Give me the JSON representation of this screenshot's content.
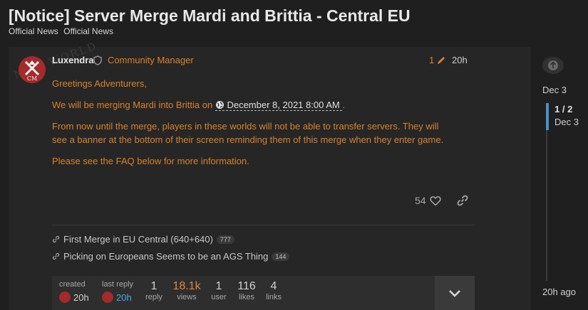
{
  "topic": {
    "title": "[Notice] Server Merge Mardi and Brittia - Central EU",
    "categories": [
      "Official News",
      "Official News"
    ]
  },
  "post": {
    "username": "Luxendra",
    "role": "Community Manager",
    "edit_count": "1",
    "time": "20h",
    "greeting": "Greetings Adventurers,",
    "merge_prefix": "We will be merging ",
    "merge_from": "Mardi",
    "merge_mid": " into ",
    "merge_to": "Brittia",
    "merge_on": " on ",
    "merge_date": "December 8, 2021 8:00 AM",
    "merge_end": " .",
    "para2_line1": "From now until the merge, players in these worlds will not be able to transfer servers. They will",
    "para2_line2": "see a banner at the bottom of their screen reminding them of this merge when they enter game.",
    "para3": "Please see the FAQ below for more information.",
    "likes": "54",
    "watermark": "NEW WORLD"
  },
  "related_links": [
    {
      "title": "First Merge in EU Central (640+640)",
      "count": "777"
    },
    {
      "title": "Picking on Europeans Seems to be an AGS Thing",
      "count": "144"
    }
  ],
  "stats": {
    "created_label": "created",
    "created_time": "20h",
    "last_reply_label": "last reply",
    "last_reply_time": "20h",
    "reply_count": "1",
    "reply_label": "reply",
    "views_count": "18.1k",
    "views_label": "views",
    "user_count": "1",
    "user_label": "user",
    "likes_count": "116",
    "likes_label": "likes",
    "links_count": "4",
    "links_label": "links"
  },
  "timeline": {
    "top_date": "Dec 3",
    "position": "1 / 2",
    "position_date": "Dec 3",
    "bottom": "20h ago"
  },
  "colors": {
    "accent": "#d9822b",
    "brand_red": "#a52a2a",
    "timeline_blue": "#4a90c8"
  }
}
